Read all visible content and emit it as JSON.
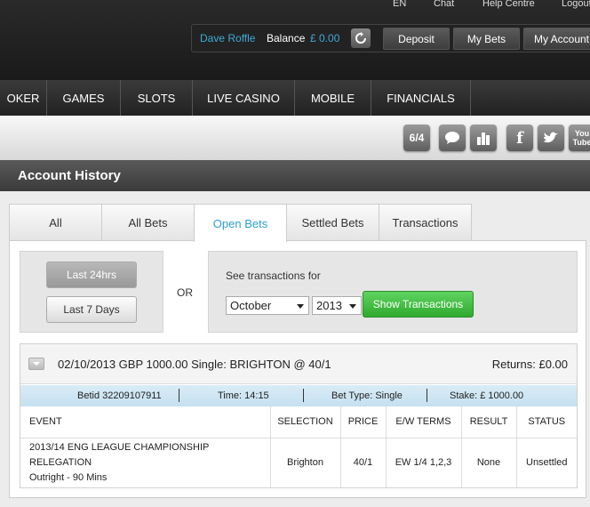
{
  "top_links": [
    "EN",
    "Chat",
    "Help Centre",
    "Logout"
  ],
  "account": {
    "username": "Dave Roffle",
    "balance_label": "Balance",
    "balance_value": "£ 0.00",
    "deposit": "Deposit",
    "my_bets": "My Bets",
    "my_account": "My Account"
  },
  "nav": [
    "OKER",
    "GAMES",
    "SLOTS",
    "LIVE CASINO",
    "MOBILE",
    "FINANCIALS"
  ],
  "social": {
    "odds_label": "6/4",
    "youtube_label": "You Tube"
  },
  "page_title": "Account History",
  "tabs": [
    "All",
    "All Bets",
    "Open Bets",
    "Settled Bets",
    "Transactions"
  ],
  "active_tab": "Open Bets",
  "filters": {
    "last_24": "Last 24hrs",
    "last_7": "Last 7 Days",
    "or": "OR",
    "see_label": "See transactions for",
    "month": "October",
    "year": "2013",
    "show_button": "Show Transactions"
  },
  "bet": {
    "summary": "02/10/2013 GBP 1000.00 Single: BRIGHTON @ 40/1",
    "returns": "Returns: £0.00",
    "betid": "Betid 32209107911",
    "time": "Time: 14:15",
    "bet_type": "Bet Type: Single",
    "stake": "Stake: £ 1000.00",
    "columns": [
      "EVENT",
      "SELECTION",
      "PRICE",
      "E/W TERMS",
      "RESULT",
      "STATUS"
    ],
    "row": {
      "event_line1": "2013/14 ENG LEAGUE CHAMPIONSHIP RELEGATION",
      "event_line2": "Outright - 90 Mins",
      "selection": "Brighton",
      "price": "40/1",
      "ew_terms": "EW 1/4 1,2,3",
      "result": "None",
      "status": "Unsettled"
    }
  },
  "colors": {
    "accent_blue": "#2a9fd0",
    "show_button_green": "#3fbf3f",
    "info_bar": "#cfe6f3"
  }
}
